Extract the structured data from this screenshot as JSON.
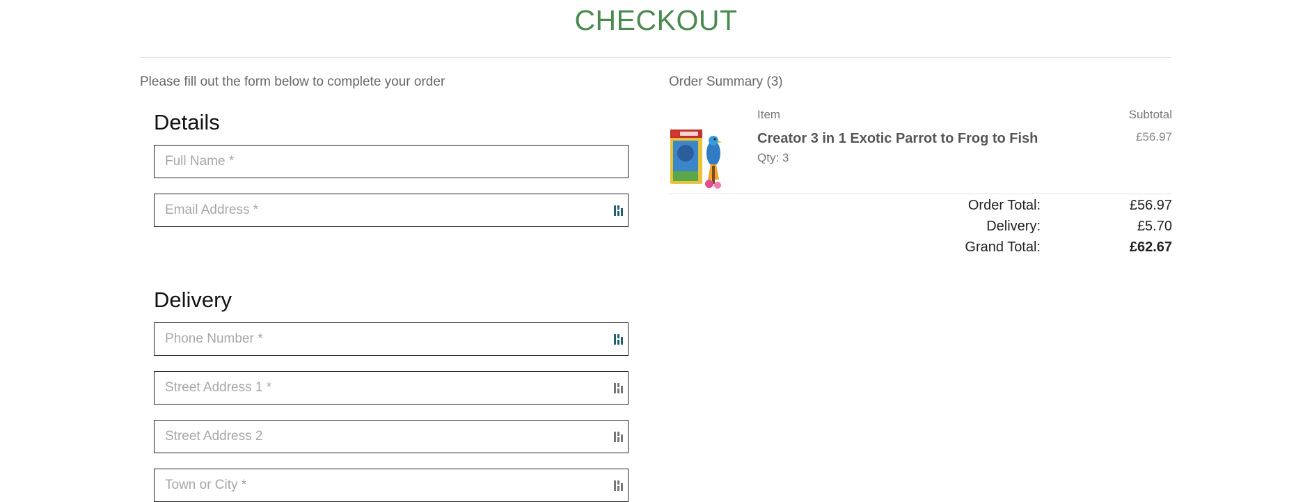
{
  "header": {
    "title": "CHECKOUT",
    "intro": "Please fill out the form below to complete your order"
  },
  "details": {
    "heading": "Details",
    "full_name_placeholder": "Full Name *",
    "email_placeholder": "Email Address *"
  },
  "delivery": {
    "heading": "Delivery",
    "phone_placeholder": "Phone Number *",
    "street1_placeholder": "Street Address 1 *",
    "street2_placeholder": "Street Address 2",
    "town_placeholder": "Town or City *"
  },
  "summary": {
    "title": "Order Summary (3)",
    "col_item": "Item",
    "col_subtotal": "Subtotal",
    "items": [
      {
        "name": "Creator 3 in 1 Exotic Parrot to Frog to Fish",
        "qty": "Qty: 3",
        "subtotal": "£56.97"
      }
    ],
    "order_total_label": "Order Total:",
    "order_total_value": "£56.97",
    "delivery_label": "Delivery:",
    "delivery_value": "£5.70",
    "grand_total_label": "Grand Total:",
    "grand_total_value": "£62.67"
  },
  "colors": {
    "title_green": "#4a8a4e",
    "field_icon_teal": "#1f5f6f"
  },
  "icons": {
    "field_autofill": "password-manager-icon",
    "product": "lego-parrot-box-thumbnail"
  }
}
